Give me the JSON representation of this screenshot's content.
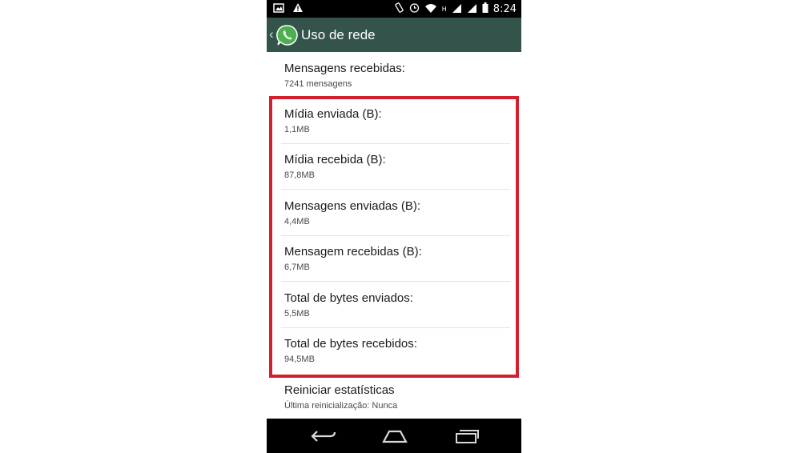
{
  "status_bar": {
    "time": "8:24",
    "icons": [
      "image-icon",
      "warning-icon",
      "rotate-icon",
      "alarm-icon",
      "wifi-icon",
      "signal-h-icon",
      "signal-icon",
      "battery-icon"
    ],
    "network_label": "H"
  },
  "app_bar": {
    "title": "Uso de rede",
    "brand_color": "#34534b",
    "logo_color": "#4caf50"
  },
  "stats": {
    "messages_received": {
      "label": "Mensagens recebidas:",
      "value": "7241 mensagens"
    },
    "media_sent": {
      "label": "Mídia enviada (B):",
      "value": "1,1MB"
    },
    "media_received": {
      "label": "Mídia recebida (B):",
      "value": "87,8MB"
    },
    "messages_sent_bytes": {
      "label": "Mensagens enviadas (B):",
      "value": "4,4MB"
    },
    "messages_received_bytes": {
      "label": "Mensagem recebidas (B):",
      "value": "6,7MB"
    },
    "total_bytes_sent": {
      "label": "Total de bytes enviados:",
      "value": "5,5MB"
    },
    "total_bytes_received": {
      "label": "Total de bytes recebidos:",
      "value": "94,5MB"
    },
    "reset": {
      "label": "Reiniciar estatísticas",
      "value": "Última reinicialização: Nunca"
    }
  },
  "highlight_color": "#d2202f",
  "nav_bar": {
    "icons": [
      "back-icon",
      "home-icon",
      "recent-apps-icon"
    ]
  }
}
